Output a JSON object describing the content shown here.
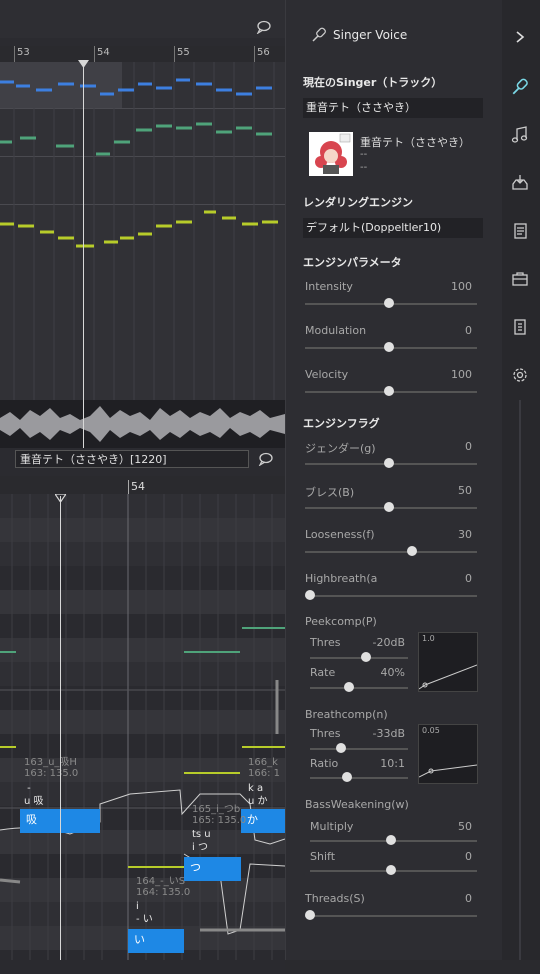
{
  "editor": {
    "ruler_top": [
      "53",
      "54",
      "55",
      "56"
    ],
    "ruler_bottom": [
      "54"
    ],
    "track_label": "重音テト（ささやき）[1220]",
    "notes": [
      {
        "info": "163_u_吸H\n163: 135.0",
        "lyric": " -\nu 吸",
        "text": "吸"
      },
      {
        "info": "166_k\n166: 1",
        "lyric": "k a\nu か",
        "text": "か"
      },
      {
        "info": "165_i_つb\n165: 135.0",
        "lyric": "ts u\ni つ",
        "text": "つ"
      },
      {
        "info": "164_-_いS\n164: 135.0",
        "lyric": "i\n- い",
        "text": "い"
      }
    ]
  },
  "panel": {
    "title": "Singer Voice",
    "current_singer_label": "現在のSinger（トラック）",
    "current_singer_value": "重音テト（ささやき）",
    "singer_name": "重音テト（ささやき）",
    "singer_line2": "--",
    "singer_line3": "--",
    "rendering_label": "レンダリングエンジン",
    "rendering_value": "デフォルト(Doppeltler10)",
    "engine_params_label": "エンジンパラメータ",
    "engine_params": [
      {
        "label": "Intensity",
        "value": "100"
      },
      {
        "label": "Modulation",
        "value": "0"
      },
      {
        "label": "Velocity",
        "value": "100"
      }
    ],
    "engine_flags_label": "エンジンフラグ",
    "flags": [
      {
        "label": "ジェンダー(g)",
        "value": "0"
      },
      {
        "label": "ブレス(B)",
        "value": "50"
      },
      {
        "label": "Looseness(f)",
        "value": "30"
      },
      {
        "label": "Highbreath(a",
        "value": "0"
      }
    ],
    "peekcomp": {
      "label": "Peekcomp(P)",
      "thres_label": "Thres",
      "thres_value": "-20dB",
      "rate_label": "Rate",
      "rate_value": "40%",
      "graph_label": "1.0"
    },
    "breathcomp": {
      "label": "Breathcomp(n)",
      "thres_label": "Thres",
      "thres_value": "-33dB",
      "ratio_label": "Ratio",
      "ratio_value": "10:1",
      "graph_label": "0.05"
    },
    "bass": {
      "label": "BassWeakening(w)",
      "multiply_label": "Multiply",
      "multiply_value": "50",
      "shift_label": "Shift",
      "shift_value": "0"
    },
    "threads": {
      "label": "Threads(S)",
      "value": "0"
    }
  },
  "colors": {
    "accent": "#7ad8e6",
    "note_blue": "#1e88e5",
    "pitch_blue": "#3d7fe0",
    "pitch_green": "#4fa37a",
    "pitch_yellow": "#b7cc2a"
  }
}
